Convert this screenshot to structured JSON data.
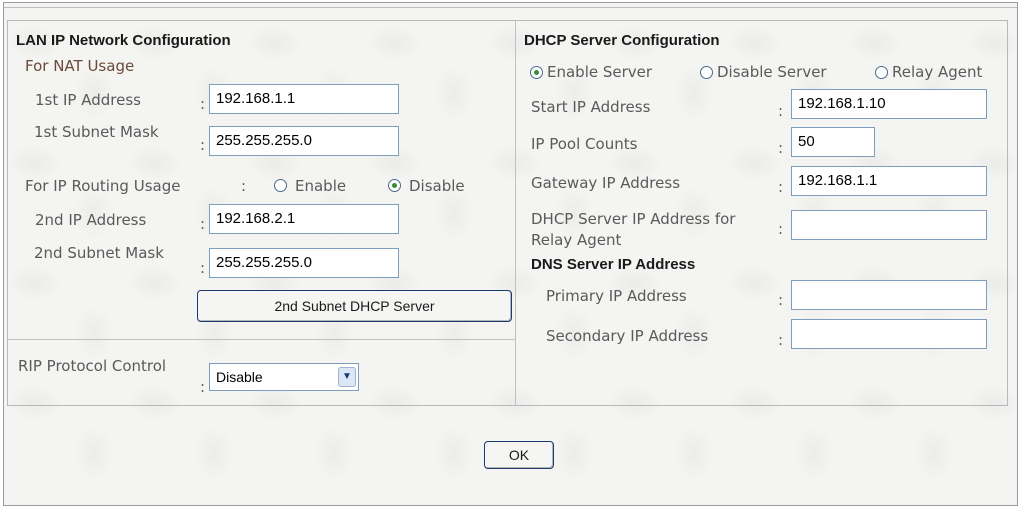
{
  "lan": {
    "title": "LAN IP Network Configuration",
    "nat_heading": "For NAT Usage",
    "ip1_label": "1st IP Address",
    "ip1_value": "192.168.1.1",
    "mask1_label": "1st Subnet Mask",
    "mask1_value": "255.255.255.0",
    "routing_label": "For IP Routing Usage",
    "routing_options": [
      "Enable",
      "Disable"
    ],
    "routing_selected": "Disable",
    "ip2_label": "2nd IP Address",
    "ip2_value": "192.168.2.1",
    "mask2_label": "2nd Subnet Mask",
    "mask2_value": "255.255.255.0",
    "dhcp2_button": "2nd Subnet DHCP Server",
    "rip_label": "RIP Protocol Control",
    "rip_value": "Disable"
  },
  "dhcp": {
    "title": "DHCP Server Configuration",
    "mode_options": [
      "Enable Server",
      "Disable Server",
      "Relay Agent"
    ],
    "mode_selected": "Enable Server",
    "start_ip_label": "Start IP Address",
    "start_ip_value": "192.168.1.10",
    "pool_label": "IP Pool Counts",
    "pool_value": "50",
    "gateway_label": "Gateway IP Address",
    "gateway_value": "192.168.1.1",
    "relay_label": "DHCP Server IP Address for Relay Agent",
    "relay_value": "",
    "dns_title": "DNS Server IP Address",
    "primary_label": "Primary IP Address",
    "primary_value": "",
    "secondary_label": "Secondary IP Address",
    "secondary_value": ""
  },
  "colon": ":",
  "ok_label": "OK",
  "colors": {
    "label": "#5a5a5a",
    "title": "#1a1a1a",
    "input_border": "#7d9dbd",
    "button_border": "#1c3a6a"
  },
  "icons": {
    "radio_selected": "radio-on-icon",
    "radio_unselected": "radio-off-icon",
    "dropdown": "chevron-down-icon"
  }
}
